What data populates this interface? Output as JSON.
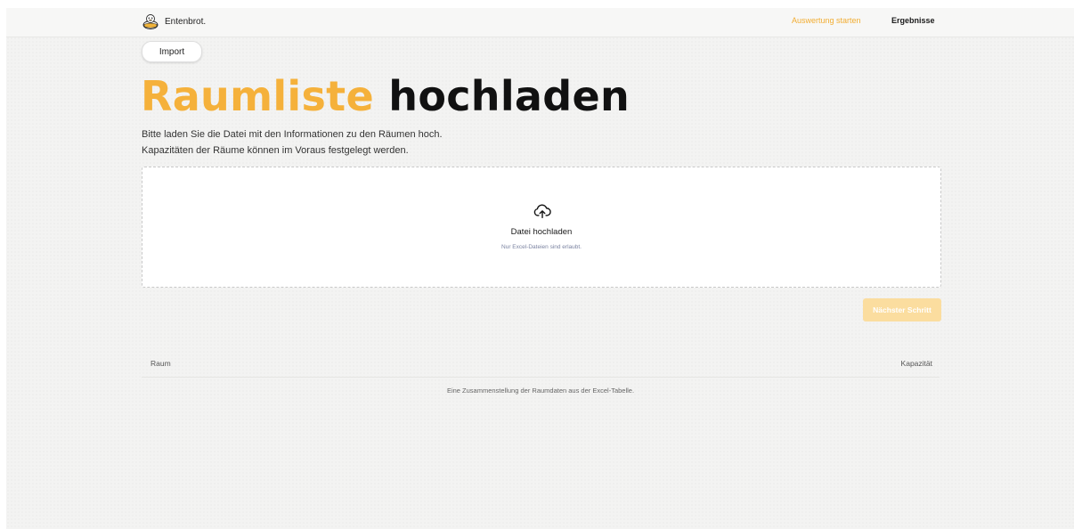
{
  "navbar": {
    "brand": "Entenbrot.",
    "links": [
      {
        "label": "Auswertung starten",
        "color": "#f2ad32"
      },
      {
        "label": "Ergebnisse"
      }
    ]
  },
  "page": {
    "tab": "Import",
    "title_accent": "Raumliste",
    "title_rest": "hochladen",
    "description_lines": [
      "Bitte laden Sie die Datei mit den Informationen zu den Räumen hoch.",
      "Kapazitäten der Räume können im Voraus festgelegt werden."
    ],
    "accent_color": "#f5b13b"
  },
  "upload": {
    "icon": "cloud-upload-icon",
    "title": "Datei hochladen",
    "hint": "Nur Excel-Dateien sind erlaubt."
  },
  "actions": {
    "next": "Nächster Schritt"
  },
  "table": {
    "columns": [
      "Raum",
      "Kapazität"
    ],
    "caption": "Eine Zusammenstellung der Raumdaten aus der Excel-Tabelle."
  }
}
